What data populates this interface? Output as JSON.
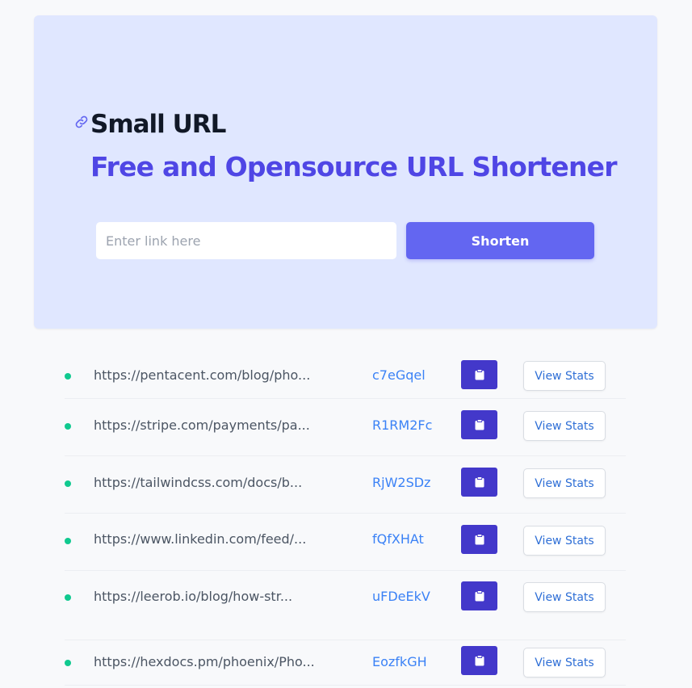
{
  "header": {
    "title": "Small URL",
    "tagline": "Free and Opensource URL Shortener"
  },
  "form": {
    "placeholder": "Enter link here",
    "value": "",
    "submit_label": "Shorten"
  },
  "colors": {
    "accent": "#4f46e5",
    "button": "#6366f1",
    "copy_button": "#4338ca",
    "status_dot": "#10c98f",
    "link": "#3b82f6",
    "hero_background": "#e0e7ff"
  },
  "icons": {
    "brand": "link-icon",
    "copy": "clipboard-icon",
    "status": "status-dot"
  },
  "links": [
    {
      "url": "https://pentacent.com/blog/pho...",
      "code": "c7eGqel",
      "stats_label": "View Stats"
    },
    {
      "url": "https://stripe.com/payments/pa...",
      "code": "R1RM2Fc",
      "stats_label": "View Stats"
    },
    {
      "url": "https://tailwindcss.com/docs/b...",
      "code": "RjW2SDz",
      "stats_label": "View Stats"
    },
    {
      "url": "https://www.linkedin.com/feed/...",
      "code": "fQfXHAt",
      "stats_label": "View Stats"
    },
    {
      "url": "https://leerob.io/blog/how-str...",
      "code": "uFDeEkV",
      "stats_label": "View Stats"
    },
    {
      "url": "https://hexdocs.pm/phoenix/Pho...",
      "code": "EozfkGH",
      "stats_label": "View Stats"
    }
  ]
}
